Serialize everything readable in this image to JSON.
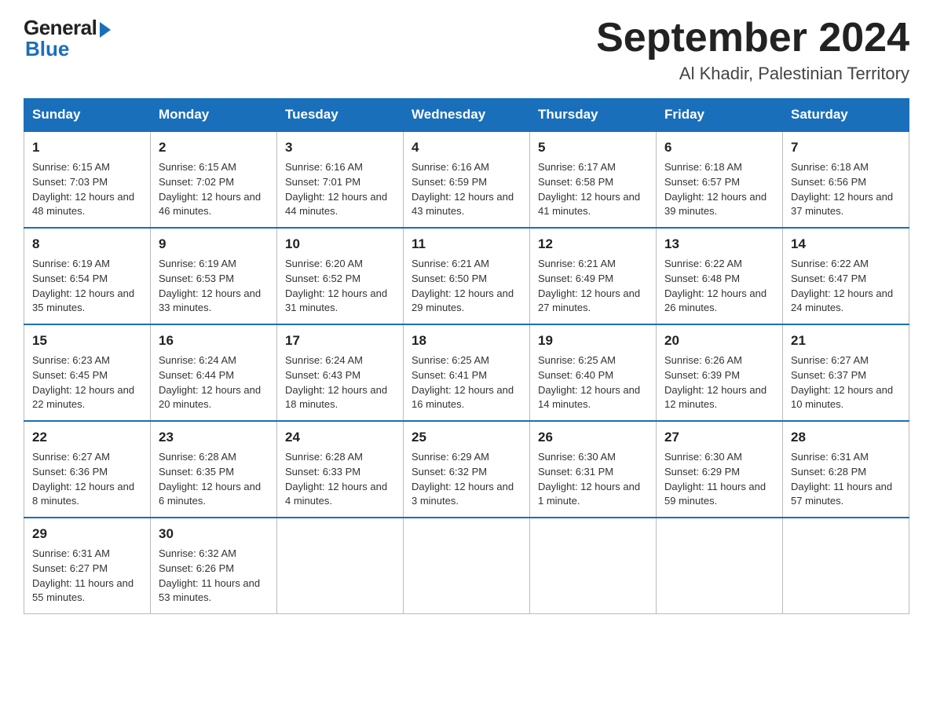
{
  "logo": {
    "general": "General",
    "blue": "Blue"
  },
  "title": "September 2024",
  "location": "Al Khadir, Palestinian Territory",
  "days_of_week": [
    "Sunday",
    "Monday",
    "Tuesday",
    "Wednesday",
    "Thursday",
    "Friday",
    "Saturday"
  ],
  "weeks": [
    [
      {
        "day": "1",
        "sunrise": "6:15 AM",
        "sunset": "7:03 PM",
        "daylight": "12 hours and 48 minutes."
      },
      {
        "day": "2",
        "sunrise": "6:15 AM",
        "sunset": "7:02 PM",
        "daylight": "12 hours and 46 minutes."
      },
      {
        "day": "3",
        "sunrise": "6:16 AM",
        "sunset": "7:01 PM",
        "daylight": "12 hours and 44 minutes."
      },
      {
        "day": "4",
        "sunrise": "6:16 AM",
        "sunset": "6:59 PM",
        "daylight": "12 hours and 43 minutes."
      },
      {
        "day": "5",
        "sunrise": "6:17 AM",
        "sunset": "6:58 PM",
        "daylight": "12 hours and 41 minutes."
      },
      {
        "day": "6",
        "sunrise": "6:18 AM",
        "sunset": "6:57 PM",
        "daylight": "12 hours and 39 minutes."
      },
      {
        "day": "7",
        "sunrise": "6:18 AM",
        "sunset": "6:56 PM",
        "daylight": "12 hours and 37 minutes."
      }
    ],
    [
      {
        "day": "8",
        "sunrise": "6:19 AM",
        "sunset": "6:54 PM",
        "daylight": "12 hours and 35 minutes."
      },
      {
        "day": "9",
        "sunrise": "6:19 AM",
        "sunset": "6:53 PM",
        "daylight": "12 hours and 33 minutes."
      },
      {
        "day": "10",
        "sunrise": "6:20 AM",
        "sunset": "6:52 PM",
        "daylight": "12 hours and 31 minutes."
      },
      {
        "day": "11",
        "sunrise": "6:21 AM",
        "sunset": "6:50 PM",
        "daylight": "12 hours and 29 minutes."
      },
      {
        "day": "12",
        "sunrise": "6:21 AM",
        "sunset": "6:49 PM",
        "daylight": "12 hours and 27 minutes."
      },
      {
        "day": "13",
        "sunrise": "6:22 AM",
        "sunset": "6:48 PM",
        "daylight": "12 hours and 26 minutes."
      },
      {
        "day": "14",
        "sunrise": "6:22 AM",
        "sunset": "6:47 PM",
        "daylight": "12 hours and 24 minutes."
      }
    ],
    [
      {
        "day": "15",
        "sunrise": "6:23 AM",
        "sunset": "6:45 PM",
        "daylight": "12 hours and 22 minutes."
      },
      {
        "day": "16",
        "sunrise": "6:24 AM",
        "sunset": "6:44 PM",
        "daylight": "12 hours and 20 minutes."
      },
      {
        "day": "17",
        "sunrise": "6:24 AM",
        "sunset": "6:43 PM",
        "daylight": "12 hours and 18 minutes."
      },
      {
        "day": "18",
        "sunrise": "6:25 AM",
        "sunset": "6:41 PM",
        "daylight": "12 hours and 16 minutes."
      },
      {
        "day": "19",
        "sunrise": "6:25 AM",
        "sunset": "6:40 PM",
        "daylight": "12 hours and 14 minutes."
      },
      {
        "day": "20",
        "sunrise": "6:26 AM",
        "sunset": "6:39 PM",
        "daylight": "12 hours and 12 minutes."
      },
      {
        "day": "21",
        "sunrise": "6:27 AM",
        "sunset": "6:37 PM",
        "daylight": "12 hours and 10 minutes."
      }
    ],
    [
      {
        "day": "22",
        "sunrise": "6:27 AM",
        "sunset": "6:36 PM",
        "daylight": "12 hours and 8 minutes."
      },
      {
        "day": "23",
        "sunrise": "6:28 AM",
        "sunset": "6:35 PM",
        "daylight": "12 hours and 6 minutes."
      },
      {
        "day": "24",
        "sunrise": "6:28 AM",
        "sunset": "6:33 PM",
        "daylight": "12 hours and 4 minutes."
      },
      {
        "day": "25",
        "sunrise": "6:29 AM",
        "sunset": "6:32 PM",
        "daylight": "12 hours and 3 minutes."
      },
      {
        "day": "26",
        "sunrise": "6:30 AM",
        "sunset": "6:31 PM",
        "daylight": "12 hours and 1 minute."
      },
      {
        "day": "27",
        "sunrise": "6:30 AM",
        "sunset": "6:29 PM",
        "daylight": "11 hours and 59 minutes."
      },
      {
        "day": "28",
        "sunrise": "6:31 AM",
        "sunset": "6:28 PM",
        "daylight": "11 hours and 57 minutes."
      }
    ],
    [
      {
        "day": "29",
        "sunrise": "6:31 AM",
        "sunset": "6:27 PM",
        "daylight": "11 hours and 55 minutes."
      },
      {
        "day": "30",
        "sunrise": "6:32 AM",
        "sunset": "6:26 PM",
        "daylight": "11 hours and 53 minutes."
      },
      null,
      null,
      null,
      null,
      null
    ]
  ]
}
